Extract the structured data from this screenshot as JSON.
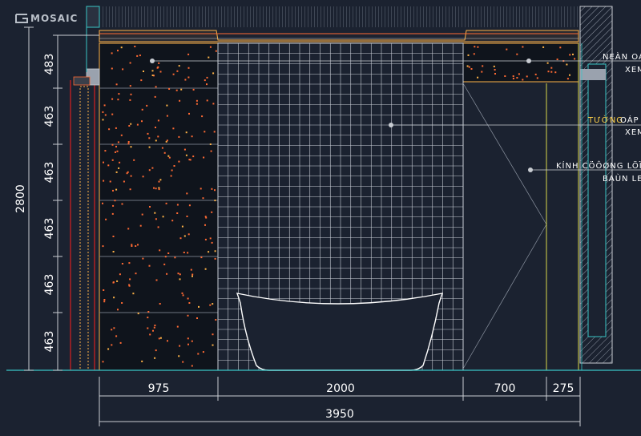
{
  "logo": {
    "text": "MOSAIC"
  },
  "dimensions": {
    "left": [
      "483",
      "463",
      "463",
      "463",
      "463",
      "463"
    ],
    "total_height": "2800",
    "bottom": [
      "975",
      "2000",
      "700",
      "275"
    ],
    "total_width": "3950"
  },
  "notes": {
    "note1_line1": "NEÀN OÁ",
    "note1_line2": "XEM",
    "note2_line1_a": "TƯỜNG",
    "note2_line1_b": "OÁP",
    "note2_line2": "XEM",
    "note3_line1": "KÍNH CÖÔØNG LÖÏC",
    "note3_line2": "BAÙN LE"
  },
  "colors": {
    "background": "#1b2230",
    "grid": "#c9ced6",
    "stone": "#0f141c",
    "speckle": "#ff6a33",
    "edge": "#ffb347",
    "wall_red": "#d62020",
    "glass_line": "#d8d84a",
    "dim_line": "#c8ccd2",
    "cyan": "#39c6c6"
  }
}
